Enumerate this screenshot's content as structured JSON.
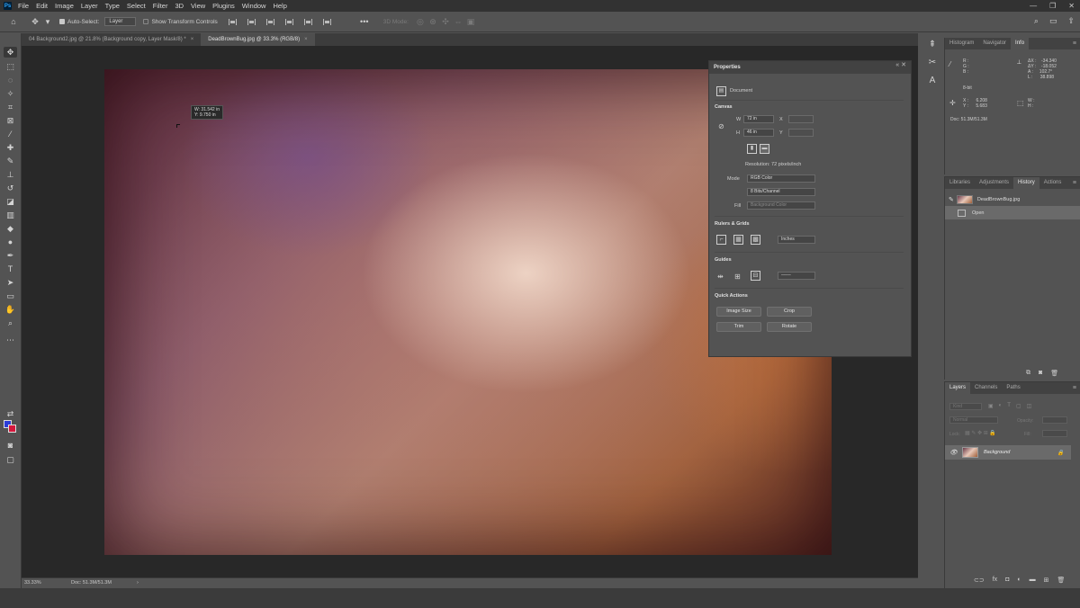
{
  "menubar": {
    "logo": "Ps",
    "items": [
      "File",
      "Edit",
      "Image",
      "Layer",
      "Type",
      "Select",
      "Filter",
      "3D",
      "View",
      "Plugins",
      "Window",
      "Help"
    ],
    "window_controls": [
      "—",
      "❐",
      "✕"
    ]
  },
  "options": {
    "auto_select_label": "Auto-Select:",
    "auto_select_value": "Layer",
    "transform_label": "Show Transform Controls",
    "mode_3d_label": "3D Mode:"
  },
  "tabs": [
    {
      "label": "04 Background2.jpg @ 21.8% (Background copy, Layer Mask/8) *",
      "close": "×"
    },
    {
      "label": "DeadBrownBug.jpg @ 33.3% (RGB/8)",
      "close": "×"
    }
  ],
  "canvas": {
    "tooltip_w": "W: 31.542 in",
    "tooltip_h": "Y:   9.750 in"
  },
  "properties": {
    "title": "Properties",
    "document_label": "Document",
    "canvas_section": "Canvas",
    "w_label": "W",
    "w_value": "72 in",
    "h_label": "H",
    "h_value": "46 in",
    "x_label": "X",
    "y_label": "Y",
    "resolution": "Resolution: 72 pixels/inch",
    "mode_label": "Mode",
    "mode_value": "RGB Color",
    "bits_value": "8 Bits/Channel",
    "fill_label": "Fill",
    "fill_value": "Background Color",
    "rulers_section": "Rulers & Grids",
    "units_value": "Inches",
    "guides_section": "Guides",
    "quick_actions_section": "Quick Actions",
    "btn_image_size": "Image Size",
    "btn_crop": "Crop",
    "btn_trim": "Trim",
    "btn_rotate": "Rotate"
  },
  "info_panel": {
    "tabs": [
      "Histogram",
      "Navigator",
      "Info"
    ],
    "active_tab": "Info",
    "r_line": "R :\nG :\nB :",
    "bit_depth": "8-bit",
    "right_vals": "ΔX :    -34.340\nΔY :    -18.052\nA :     102.7°\nL :      38.898",
    "x_line": "X :      6.208\nY :      5.683",
    "w_line": "W :\nH :",
    "doc_size": "Doc: 51.3M/51.3M"
  },
  "history_panel": {
    "tabs": [
      "Libraries",
      "Adjustments",
      "History",
      "Actions"
    ],
    "active_tab": "History",
    "snapshot": "DeadBrownBug.jpg",
    "state": "Open"
  },
  "layers_panel": {
    "tabs": [
      "Layers",
      "Channels",
      "Paths"
    ],
    "active_tab": "Layers",
    "kind_placeholder": "Kind",
    "blend_mode": "Normal",
    "opacity_label": "Opacity:",
    "lock_label": "Lock:",
    "fill_label": "Fill:",
    "layer_name": "Background"
  },
  "status": {
    "zoom": "33.33%",
    "doc": "Doc: 51.3M/51.3M",
    "arrow": "›"
  },
  "colors": {
    "foreground": "#2b3cd6",
    "background": "#d5183c"
  }
}
